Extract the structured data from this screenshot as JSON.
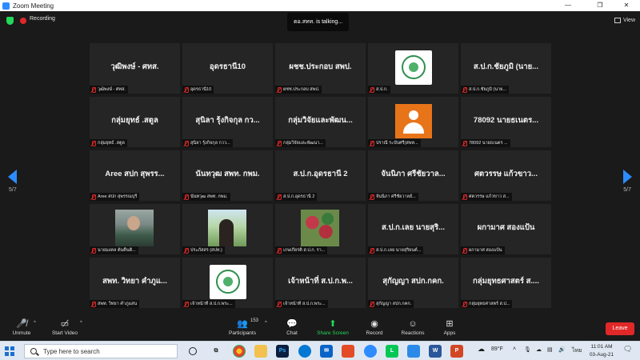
{
  "window": {
    "title": "Zoom Meeting",
    "minimize": "—",
    "maximize": "❐",
    "close": "✕"
  },
  "status": {
    "recording": "Recording",
    "talking": "ตอ.สทท. is talking...",
    "view": "View",
    "page": "5/7"
  },
  "tiles": [
    {
      "big": "วุฒิพงษ์ - ศทส.",
      "name": "วุฒิพงษ์ - ศทส.",
      "kind": "text"
    },
    {
      "big": "อุดรธานี10",
      "name": "อุดรธานี10",
      "kind": "text"
    },
    {
      "big": "ผชช.ประกอบ สพป.",
      "name": "ผชช.ประกอบ สพป.",
      "kind": "text"
    },
    {
      "big": "",
      "name": "ส.ป.ก.",
      "kind": "logo"
    },
    {
      "big": "ส.ป.ก.ชัยภูมิ (นาย...",
      "name": "ส.ป.ก.ชัยภูมิ (นาย...",
      "kind": "text"
    },
    {
      "big": "กลุ่มยุทธ์ .สตูล",
      "name": "กลุ่มยุทธ์ .สตูล",
      "kind": "text"
    },
    {
      "big": "สุนิลา รุ้งกิจกุล กว...",
      "name": "สุนิลา รุ้งกิจกุล กวว...",
      "kind": "text"
    },
    {
      "big": "กลุ่มวิจัยและพัฒน...",
      "name": "กลุ่มวิจัยและพัฒนา...",
      "kind": "text"
    },
    {
      "big": "",
      "name": "ปราณี ระบับศรี(สพท...",
      "kind": "avatar"
    },
    {
      "big": "78092 นายธเนตร...",
      "name": "78092 นายธเนตร ...",
      "kind": "text"
    },
    {
      "big": "Aree สปก สุพรร...",
      "name": "Aree สปก สุพรรณบุรี",
      "kind": "text"
    },
    {
      "big": "นันทวุฒ สพท. กพม.",
      "name": "นันทวุฒ สพท. กพม.",
      "kind": "text"
    },
    {
      "big": "ส.ป.ก.อุดรธานี 2",
      "name": "ส.ป.ก.อุดรธานี 2",
      "kind": "text"
    },
    {
      "big": "จันนิภา ศรีชัยวาล...",
      "name": "จันนิภา ศรีชัยวาลย์...",
      "kind": "text"
    },
    {
      "big": "ศตวรรษ แก้วขาว...",
      "name": "ศตวรรษ แก้วขาว ส...",
      "kind": "text"
    },
    {
      "big": "",
      "name": "นายมงคล ต้นติ้นติ...",
      "kind": "photo1"
    },
    {
      "big": "",
      "name": "ประภัสสร (สปท.)",
      "kind": "photo2"
    },
    {
      "big": "",
      "name": "เกษเกียรติ ส.ป.ก. รา...",
      "kind": "photo3"
    },
    {
      "big": "ส.ป.ก.เลย นายสุริ...",
      "name": "ส.ป.ก.เลย นายสุริยนต์...",
      "kind": "text"
    },
    {
      "big": "ผกามาศ สองแป้น",
      "name": "ผกามาศ สองแป้น",
      "kind": "text"
    },
    {
      "big": "สพท. วิทยา คำภูแ...",
      "name": "สพท. วิทยา คำภูแสน",
      "kind": "text"
    },
    {
      "big": "",
      "name": "เจ้าหน้าที่ ส.ป.ก.พระ...",
      "kind": "logo"
    },
    {
      "big": "เจ้าหน้าที่ ส.ป.ก.พ...",
      "name": "เจ้าหน้าที่ ส.ป.ก.พระ...",
      "kind": "text"
    },
    {
      "big": "สุกัญญา สปก.กคก.",
      "name": "สุกัญญา สปก.กคก.",
      "kind": "text"
    },
    {
      "big": "กลุ่มยุทธศาสตร์ ส....",
      "name": "กลุ่มยุทธศาสตร์ ส.ป...",
      "kind": "text"
    }
  ],
  "toolbar": {
    "unmute": "Unmute",
    "start_video": "Start Video",
    "participants": "Participants",
    "participants_count": "153",
    "chat": "Chat",
    "share_screen": "Share Screen",
    "record": "Record",
    "reactions": "Reactions",
    "apps": "Apps",
    "leave": "Leave"
  },
  "taskbar": {
    "search_placeholder": "Type here to search",
    "weather": "89°F",
    "lang": "ไทย",
    "time": "11:01 AM",
    "date": "03-Aug-21"
  },
  "colors": {
    "accent": "#2d8cff",
    "share_green": "#23d959",
    "leave_red": "#e02828",
    "mute_red": "#e02828"
  }
}
